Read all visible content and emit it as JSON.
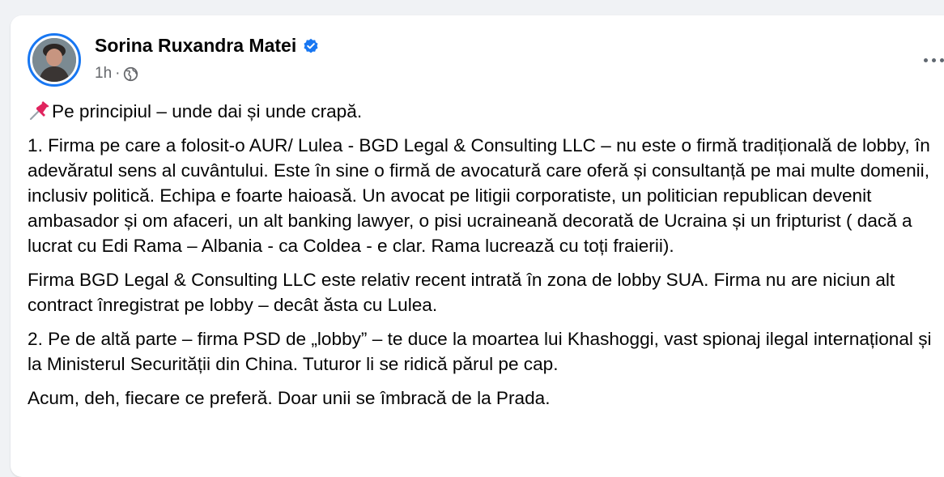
{
  "post": {
    "author": "Sorina Ruxandra Matei",
    "time": "1h",
    "separator": "·",
    "paragraphs": [
      "Pe principiul – unde dai și unde crapă.",
      "1. Firma pe care a folosit-o AUR/ Lulea - BGD Legal & Consulting LLC – nu este o firmă tradițională de lobby, în adevăratul sens al cuvântului. Este în sine o firmă de avocatură care oferă și consultanță pe mai multe domenii, inclusiv politică. Echipa e foarte haioasă. Un avocat pe litigii corporatiste, un politician republican devenit ambasador și om afaceri, un alt banking lawyer, o pisi ucraineană decorată de Ucraina și un fripturist ( dacă a lucrat cu Edi Rama – Albania - ca Coldea - e clar. Rama lucrează cu toți fraierii).",
      "Firma BGD Legal & Consulting LLC este relativ recent intrată în zona de lobby SUA. Firma nu are niciun alt contract înregistrat pe lobby – decât ăsta cu Lulea.",
      "2. Pe de altă parte – firma PSD de „lobby” – te duce la moartea lui Khashoggi, vast spionaj ilegal internațional și la Ministerul Securității din China. Tuturor li se ridică părul pe cap.",
      "Acum, deh, fiecare ce preferă. Doar unii se îmbracă de la Prada."
    ],
    "icons": {
      "verified": "verified-badge-icon",
      "audience": "globe-icon",
      "more": "more-options-icon",
      "first_paragraph_emoji": "pushpin-icon"
    }
  },
  "colors": {
    "accent": "#1877f2",
    "text": "#050505",
    "secondary_text": "#65676b",
    "background": "#f0f2f5"
  }
}
